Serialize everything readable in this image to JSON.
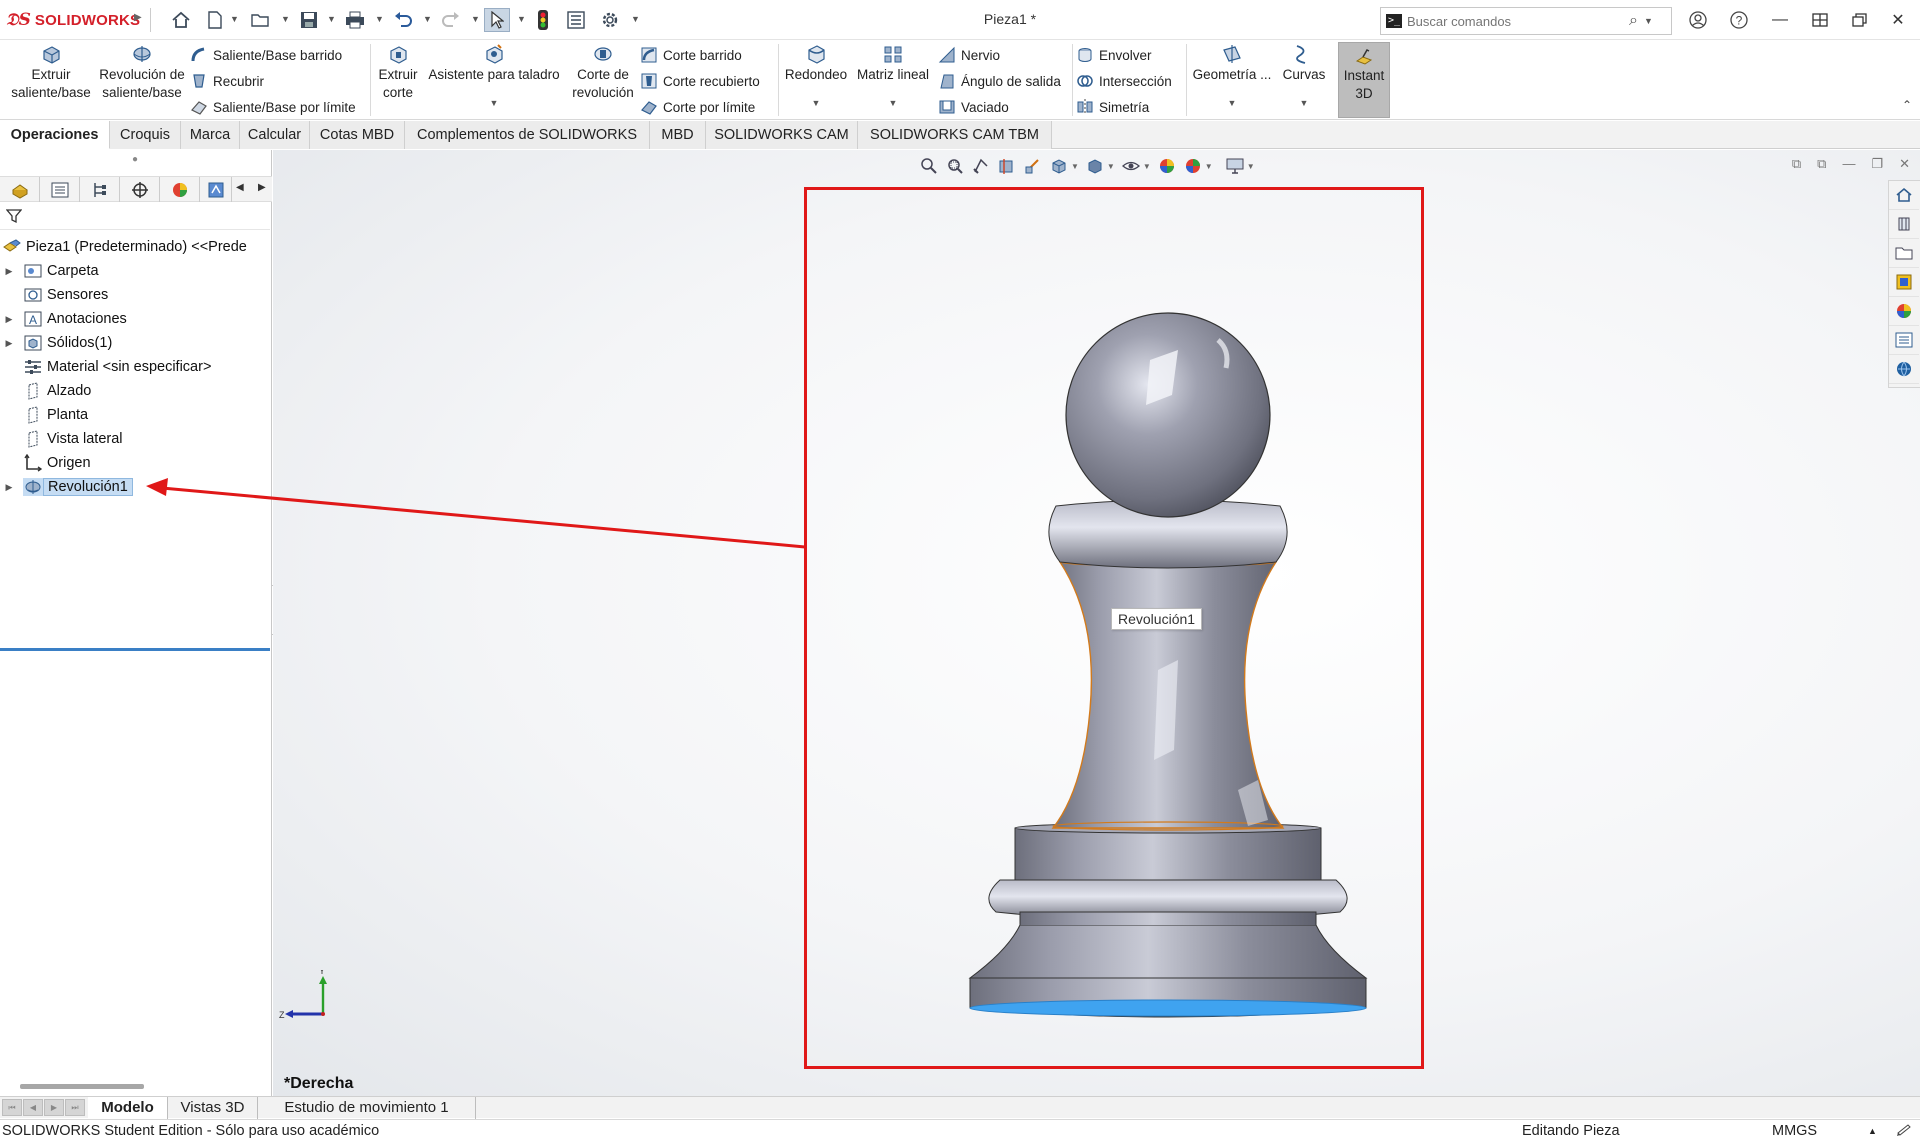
{
  "app": {
    "brand": "SOLIDWORKS",
    "document_title": "Pieza1 *"
  },
  "search": {
    "placeholder": "Buscar comandos"
  },
  "ribbon": {
    "extruir_saliente": "Extruir saliente/base",
    "revolucion_saliente": "Revolución de saliente/base",
    "saliente_barrido": "Saliente/Base barrido",
    "recubrir": "Recubrir",
    "saliente_limite": "Saliente/Base por límite",
    "extruir_corte": "Extruir corte",
    "asistente_taladro": "Asistente para taladro",
    "corte_revolucion": "Corte de revolución",
    "corte_barrido": "Corte barrido",
    "corte_recubierto": "Corte recubierto",
    "corte_limite": "Corte por límite",
    "redondeo": "Redondeo",
    "matriz_lineal": "Matriz lineal",
    "nervio": "Nervio",
    "angulo_salida": "Ángulo de salida",
    "vaciado": "Vaciado",
    "envolver": "Envolver",
    "interseccion": "Intersección",
    "simetria": "Simetría",
    "geometria": "Geometría ...",
    "curvas": "Curvas",
    "instant3d": "Instant 3D"
  },
  "command_tabs": [
    "Operaciones",
    "Croquis",
    "Marca",
    "Calcular",
    "Cotas MBD",
    "Complementos de SOLIDWORKS",
    "MBD",
    "SOLIDWORKS CAM",
    "SOLIDWORKS CAM TBM"
  ],
  "tree": {
    "root": "Pieza1 (Predeterminado) <<Prede",
    "items": [
      "Carpeta",
      "Sensores",
      "Anotaciones",
      "Sólidos(1)",
      "Material <sin especificar>",
      "Alzado",
      "Planta",
      "Vista lateral",
      "Origen",
      "Revolución1"
    ]
  },
  "viewport": {
    "view_name": "*Derecha",
    "tooltip": "Revolución1",
    "triad_y": "Y",
    "triad_z": "Z"
  },
  "bottom_tabs": [
    "Modelo",
    "Vistas 3D",
    "Estudio de movimiento 1"
  ],
  "status": {
    "edition": "SOLIDWORKS Student Edition - Sólo para uso académico",
    "mode": "Editando Pieza",
    "units": "MMGS"
  },
  "colors": {
    "brand_red": "#d4202a",
    "annotation_red": "#e01818",
    "selection_blue": "#c5dcf3",
    "model_gray": "#8a8c98"
  }
}
